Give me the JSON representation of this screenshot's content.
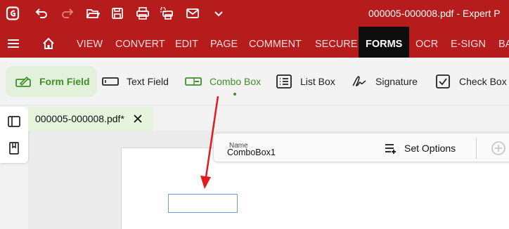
{
  "titlebar": {
    "title": "000005-000008.pdf  -  Expert P"
  },
  "menu": {
    "items": [
      "VIEW",
      "CONVERT",
      "EDIT",
      "PAGE",
      "COMMENT",
      "SECURE"
    ],
    "active": "FORMS",
    "after": [
      "OCR",
      "E-SIGN",
      "BA"
    ]
  },
  "toolbar": {
    "form_field": "Form Field",
    "text_field": "Text Field",
    "combo_box": "Combo Box",
    "list_box": "List Box",
    "signature": "Signature",
    "check_box": "Check Box"
  },
  "tab": {
    "filename": "000005-000008.pdf*"
  },
  "properties": {
    "name_label": "Name",
    "name_value": "ComboBox1",
    "set_options": "Set Options"
  },
  "colors": {
    "brand": "#b71c1c",
    "accent_green": "#3f8f27",
    "arrow": "#e01b1b"
  }
}
